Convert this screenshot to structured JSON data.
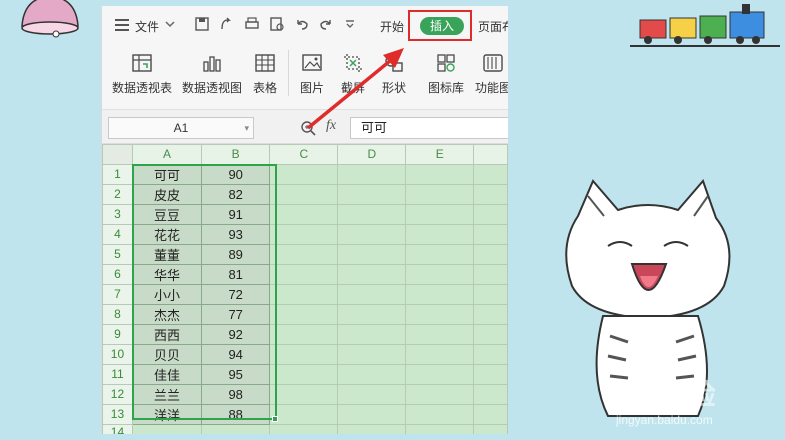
{
  "menubar": {
    "file_label": "文件",
    "start_tab": "开始",
    "insert_tab": "插入",
    "page_tab": "页面布"
  },
  "ribbon": {
    "items": [
      {
        "label": "数据透视表",
        "icon": "pivot-table-icon"
      },
      {
        "label": "数据透视图",
        "icon": "pivot-chart-icon"
      },
      {
        "label": "表格",
        "icon": "table-icon"
      },
      {
        "label": "图片",
        "icon": "picture-icon"
      },
      {
        "label": "截屏",
        "icon": "screenshot-icon"
      },
      {
        "label": "形状",
        "icon": "shapes-icon"
      },
      {
        "label": "图标库",
        "icon": "icon-library-icon"
      },
      {
        "label": "功能图",
        "icon": "function-chart-icon"
      }
    ]
  },
  "formula_bar": {
    "name_box": "A1",
    "fx_label": "fx",
    "formula_value": "可可"
  },
  "sheet": {
    "columns": [
      "A",
      "B",
      "C",
      "D",
      "E"
    ],
    "rows": [
      {
        "num": "1",
        "a": "可可",
        "b": "90"
      },
      {
        "num": "2",
        "a": "皮皮",
        "b": "82"
      },
      {
        "num": "3",
        "a": "豆豆",
        "b": "91"
      },
      {
        "num": "4",
        "a": "花花",
        "b": "93"
      },
      {
        "num": "5",
        "a": "董董",
        "b": "89"
      },
      {
        "num": "6",
        "a": "华华",
        "b": "81"
      },
      {
        "num": "7",
        "a": "小小",
        "b": "72"
      },
      {
        "num": "8",
        "a": "杰杰",
        "b": "77"
      },
      {
        "num": "9",
        "a": "西西",
        "b": "92"
      },
      {
        "num": "10",
        "a": "贝贝",
        "b": "94"
      },
      {
        "num": "11",
        "a": "佳佳",
        "b": "95"
      },
      {
        "num": "12",
        "a": "兰兰",
        "b": "98"
      },
      {
        "num": "13",
        "a": "洋洋",
        "b": "88"
      },
      {
        "num": "14",
        "a": "",
        "b": ""
      }
    ]
  },
  "watermark": {
    "logo": "Bai经验",
    "url": "jingyan.baidu.com"
  },
  "colors": {
    "accent_green": "#3aa35a",
    "highlight_red": "#e02b2b",
    "selection_green": "#2fa34b"
  }
}
